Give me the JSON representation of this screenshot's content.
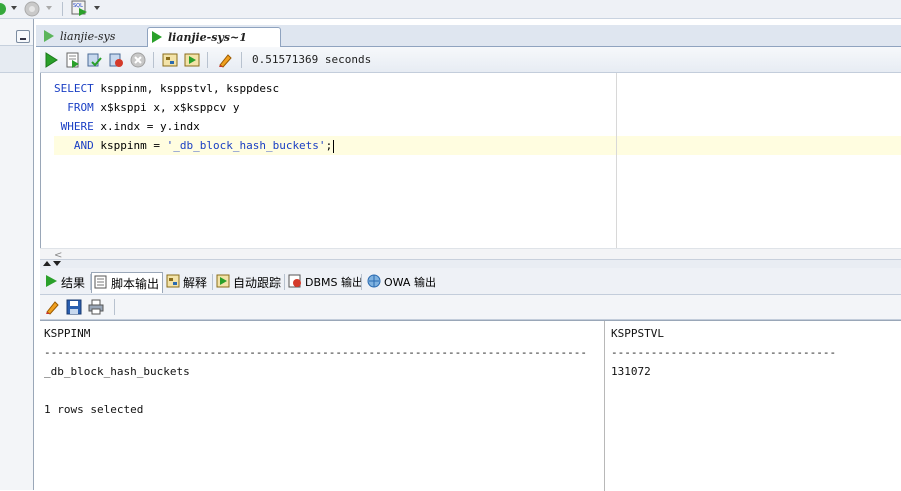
{
  "editor_tabs": [
    {
      "label": "lianjie-sys"
    },
    {
      "label": "lianjie-sys~1"
    }
  ],
  "editor_toolbar": {
    "elapsed": "0.51571369 seconds"
  },
  "editor": {
    "lines": [
      {
        "indent": "",
        "keyword": "SELECT",
        "rest": " ksppinm, ksppstvl, ksppdesc"
      },
      {
        "indent": "  ",
        "keyword": "FROM",
        "rest": " x$ksppi x, x$ksppcv y"
      },
      {
        "indent": " ",
        "keyword": "WHERE",
        "rest": " x.indx = y.indx"
      },
      {
        "indent": "   ",
        "keyword": "AND",
        "rest_pre": " ksppinm = ",
        "string": "'_db_block_hash_buckets'",
        "rest_post": ";"
      }
    ],
    "hscroll_arrow": "<"
  },
  "output_tabs": [
    {
      "label": "结果",
      "icon": "run-icon"
    },
    {
      "label": "脚本输出",
      "icon": "script-output-icon"
    },
    {
      "label": "解释",
      "icon": "explain-plan-icon"
    },
    {
      "label": "自动跟踪",
      "icon": "autotrace-icon"
    },
    {
      "label": "DBMS 输出",
      "icon": "dbms-output-icon"
    },
    {
      "label": "OWA 输出",
      "icon": "owa-output-icon"
    }
  ],
  "output": {
    "col1_header": "KSPPINM",
    "col2_header": "KSPPSTVL",
    "col1_dashes": "----------------------------------------------------------------------------------",
    "col2_dashes": "----------------------------------",
    "row1_col1": "_db_block_hash_buckets",
    "row1_col2": "131072",
    "footer": "1 rows selected"
  },
  "colors": {
    "keyword": "#1a3fc4",
    "current_line": "#fffde0",
    "run_green": "#2aa02a"
  }
}
